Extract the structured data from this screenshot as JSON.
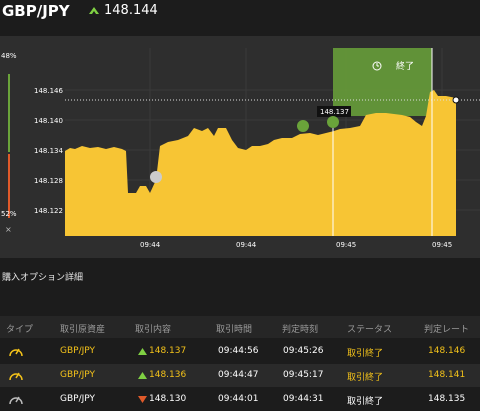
{
  "header": {
    "pair": "GBP/JPY",
    "price": "148.144",
    "price_direction": "up"
  },
  "chart": {
    "gauge_top_label": "48%",
    "gauge_bottom_label": "52%",
    "close_symbol": "×",
    "y_ticks": [
      "148.146",
      "148.140",
      "148.134",
      "148.128",
      "148.122"
    ],
    "x_ticks": [
      "09:44",
      "09:44",
      "09:45",
      "09:45"
    ],
    "current_label": "148.137",
    "end_label": "終了",
    "clock_icon": "clock-icon",
    "colors": {
      "area": "#f7c534",
      "highlight": "#6aa33a",
      "background": "#2e2e2e"
    }
  },
  "section_title": "購入オプション詳細",
  "table": {
    "headers": [
      "タイプ",
      "取引原資産",
      "取引内容",
      "取引時間",
      "判定時刻",
      "ステータス",
      "判定レート"
    ],
    "rows": [
      {
        "asset": "GBP/JPY",
        "direction": "up",
        "rate": "148.137",
        "trade_time": "09:44:56",
        "judge_time": "09:45:26",
        "status": "取引終了",
        "judge_rate": "148.146"
      },
      {
        "asset": "GBP/JPY",
        "direction": "up",
        "rate": "148.136",
        "trade_time": "09:44:47",
        "judge_time": "09:45:17",
        "status": "取引終了",
        "judge_rate": "148.141"
      },
      {
        "asset": "GBP/JPY",
        "direction": "down",
        "rate": "148.130",
        "trade_time": "09:44:01",
        "judge_time": "09:44:31",
        "status": "取引終了",
        "judge_rate": "148.135"
      }
    ]
  }
}
